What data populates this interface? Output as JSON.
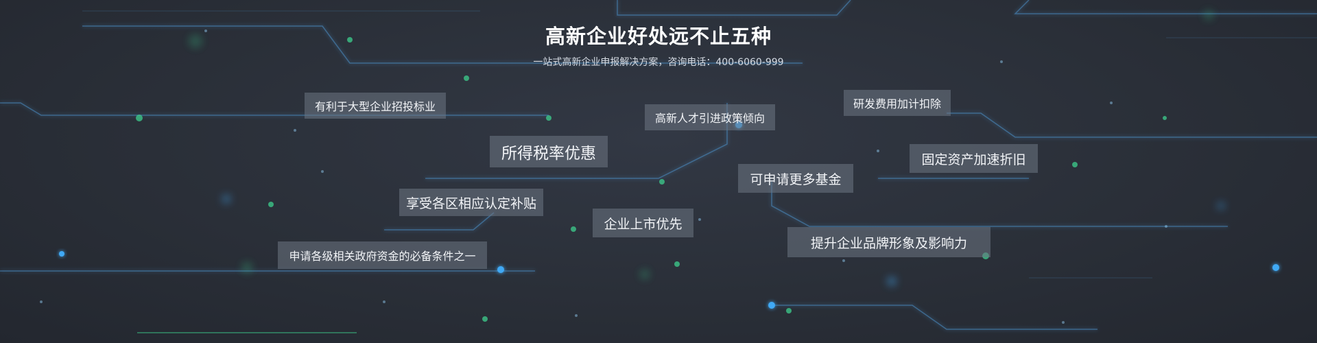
{
  "banner": {
    "title": "高新企业好处远不止五种",
    "subtitle": "一站式高新企业申报解决方案，咨询电话：400-6060-999"
  },
  "benefits": [
    "有利于大型企业招投标业",
    "所得税率优惠",
    "享受各区相应认定补贴",
    "申请各级相关政府资金的必备条件之一",
    "高新人才引进政策倾向",
    "企业上市优先",
    "可申请更多基金",
    "研发费用加计扣除",
    "固定资产加速折旧",
    "提升企业品牌形象及影响力"
  ],
  "colors": {
    "background": "#2a2f38",
    "circuit_line": "#4a8fc9",
    "glow_blue": "#3fa9f5",
    "glow_green": "#3ecf8e",
    "tag_background": "#6e7684"
  }
}
